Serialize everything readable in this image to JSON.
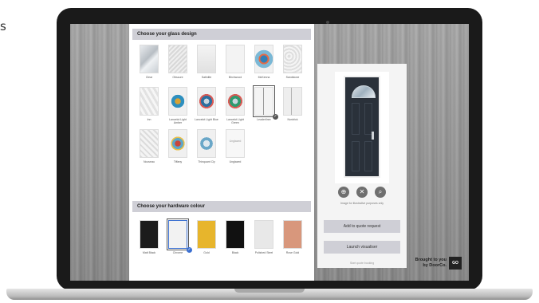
{
  "page_edge_text": "s",
  "glass_section": {
    "heading": "Choose your glass design",
    "options": [
      {
        "label": "Clear",
        "pattern": "clear"
      },
      {
        "label": "Obscure",
        "pattern": "obscure"
      },
      {
        "label": "Satinlite",
        "pattern": "satin"
      },
      {
        "label": "Birchwood",
        "pattern": "birch"
      },
      {
        "label": "McKenna",
        "pattern": "mckenna"
      },
      {
        "label": "Sandstone",
        "pattern": "sand"
      },
      {
        "label": "Inn",
        "pattern": "inn"
      },
      {
        "label": "Lancelot Light Amber",
        "pattern": "lancelot-amber"
      },
      {
        "label": "Lancelot Light Blue",
        "pattern": "lancelot-blue"
      },
      {
        "label": "Lancelot Light Green",
        "pattern": "lancelot-green"
      },
      {
        "label": "Leaderliner",
        "pattern": "leader",
        "selected": true,
        "check": "✓"
      },
      {
        "label": "Nordrick",
        "pattern": "nordrick"
      },
      {
        "label": "Nouveau",
        "pattern": "nouveau"
      },
      {
        "label": "Tiffany",
        "pattern": "tiffany"
      },
      {
        "label": "Thinquant Cly",
        "pattern": "thin"
      },
      {
        "label": "Unglazed",
        "pattern": "unglazed",
        "tile_text": "Unglazed"
      }
    ]
  },
  "hardware_section": {
    "heading": "Choose your hardware colour",
    "options": [
      {
        "label": "Matt Black",
        "color": "#1c1c1c"
      },
      {
        "label": "Chrome",
        "color": "#f2f2f2",
        "selected": true,
        "check": "✓"
      },
      {
        "label": "Gold",
        "color": "#e7b52c"
      },
      {
        "label": "Black",
        "color": "#111111"
      },
      {
        "label": "Polished Steel",
        "color": "#e8e8e8"
      },
      {
        "label": "Rose Gold",
        "color": "#d8977c"
      }
    ]
  },
  "preview": {
    "controls": [
      {
        "name": "zoom-in-icon",
        "glyph": "⊕"
      },
      {
        "name": "close-icon",
        "glyph": "✕"
      },
      {
        "name": "search-icon",
        "glyph": "⌕"
      }
    ],
    "disclaimer": "Image for illustrative purposes only",
    "add_button": "Add to quote request",
    "launch_button": "Launch visualiser",
    "link": "Start quote booking"
  },
  "branding": {
    "line1": "Brought to you",
    "line2": "by DoorCo.",
    "logo": "GO"
  },
  "colors": {
    "section_header": "#cfcfd6",
    "door": "#2a313a",
    "selected_check": "#3a6fd1"
  }
}
